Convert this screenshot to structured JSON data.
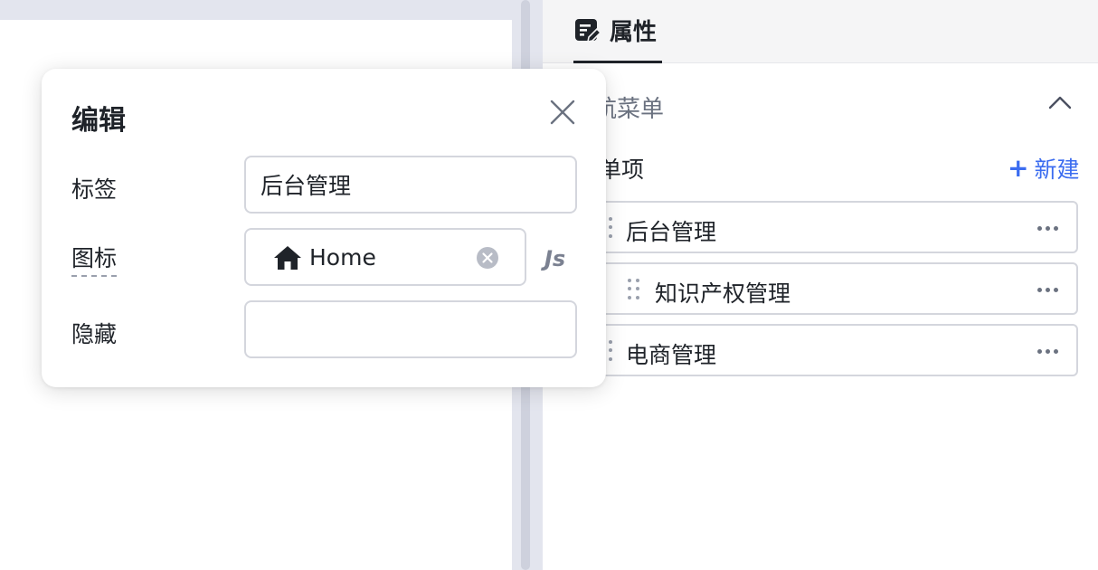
{
  "panel": {
    "tab_label": "属性",
    "section_title": "航菜单",
    "menu_subtitle": "单项",
    "new_button": "新建",
    "items": [
      {
        "label": "后台管理"
      },
      {
        "label": "知识产权管理"
      },
      {
        "label": "电商管理"
      }
    ]
  },
  "popup": {
    "title": "编辑",
    "label_field": {
      "label": "标签",
      "value": "后台管理"
    },
    "icon_field": {
      "label": "图标",
      "value": "Home",
      "icon": "home-icon"
    },
    "hidden_field": {
      "label": "隐藏",
      "value": ""
    },
    "js_toggle": "Js"
  },
  "colors": {
    "accent": "#3b6cf0",
    "text": "#1f2329",
    "muted": "#6b7280",
    "border": "#d4d6dd",
    "canvas_bg": "#e3e5ee"
  }
}
